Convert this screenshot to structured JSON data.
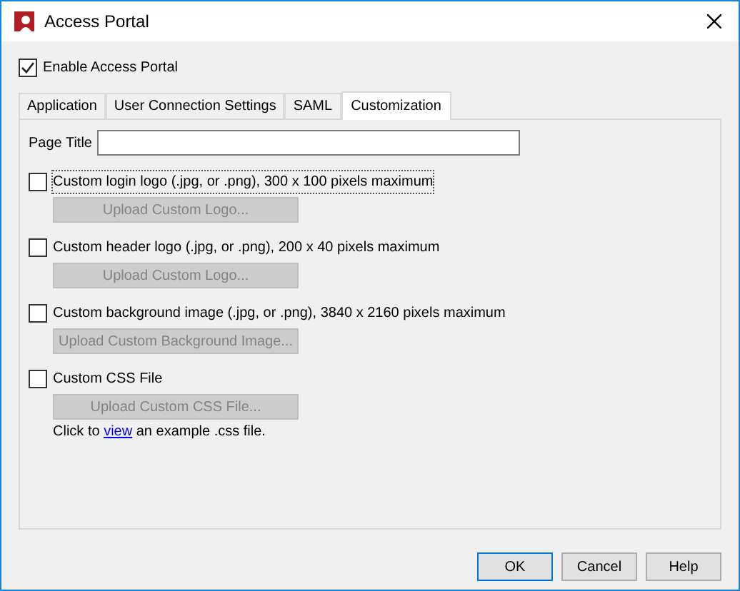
{
  "window": {
    "title": "Access Portal"
  },
  "enable": {
    "label": "Enable Access Portal",
    "checked": true
  },
  "tabs": [
    {
      "label": "Application",
      "selected": false
    },
    {
      "label": "User Connection Settings",
      "selected": false
    },
    {
      "label": "SAML",
      "selected": false
    },
    {
      "label": "Customization",
      "selected": true
    }
  ],
  "page_title": {
    "label": "Page Title"
  },
  "options": [
    {
      "label": "Custom login logo (.jpg, or .png), 300 x 100 pixels maximum",
      "checked": false,
      "focused": true,
      "button": {
        "label": "Upload Custom Logo...",
        "disabled": true
      }
    },
    {
      "label": "Custom header logo (.jpg, or .png), 200 x 40 pixels maximum",
      "checked": false,
      "focused": false,
      "button": {
        "label": "Upload Custom Logo...",
        "disabled": true
      }
    },
    {
      "label": "Custom background image (.jpg, or .png), 3840 x 2160 pixels maximum",
      "checked": false,
      "focused": false,
      "button": {
        "label": "Upload Custom Background Image...",
        "disabled": true
      }
    },
    {
      "label": "Custom CSS File",
      "checked": false,
      "focused": false,
      "button": {
        "label": "Upload Custom CSS File...",
        "disabled": true
      }
    }
  ],
  "note": {
    "before": "Click to",
    "link": "view",
    "after": "an example .css file."
  },
  "buttons": [
    {
      "label": "OK",
      "default": true
    },
    {
      "label": "Cancel",
      "default": false
    },
    {
      "label": "Help",
      "default": false
    }
  ]
}
